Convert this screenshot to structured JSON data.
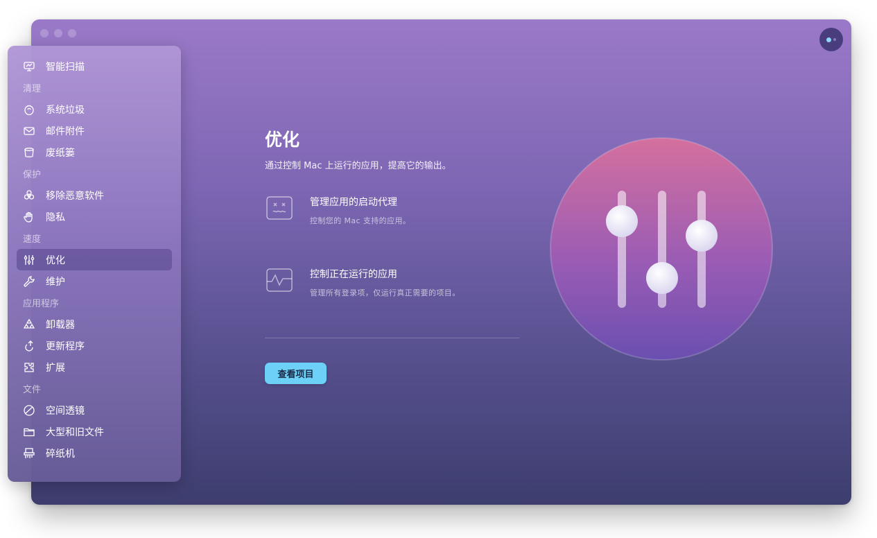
{
  "sidebar": {
    "smart_scan": "智能扫描",
    "sections": [
      {
        "label": "清理",
        "items": [
          {
            "label": "系统垃圾",
            "icon": "system-junk-icon"
          },
          {
            "label": "邮件附件",
            "icon": "mail-icon"
          },
          {
            "label": "废纸篓",
            "icon": "trash-icon"
          }
        ]
      },
      {
        "label": "保护",
        "items": [
          {
            "label": "移除恶意软件",
            "icon": "biohazard-icon"
          },
          {
            "label": "隐私",
            "icon": "hand-icon"
          }
        ]
      },
      {
        "label": "速度",
        "items": [
          {
            "label": "优化",
            "icon": "sliders-icon",
            "active": true
          },
          {
            "label": "维护",
            "icon": "wrench-icon"
          }
        ]
      },
      {
        "label": "应用程序",
        "items": [
          {
            "label": "卸载器",
            "icon": "uninstaller-icon"
          },
          {
            "label": "更新程序",
            "icon": "updater-icon"
          },
          {
            "label": "扩展",
            "icon": "extensions-icon"
          }
        ]
      },
      {
        "label": "文件",
        "items": [
          {
            "label": "空间透镜",
            "icon": "space-lens-icon"
          },
          {
            "label": "大型和旧文件",
            "icon": "folder-icon"
          },
          {
            "label": "碎纸机",
            "icon": "shredder-icon"
          }
        ]
      }
    ]
  },
  "main": {
    "title": "优化",
    "subtitle": "通过控制 Mac 上运行的应用，提高它的输出。",
    "features": [
      {
        "title": "管理应用的启动代理",
        "desc": "控制您的 Mac 支持的应用。",
        "icon": "launch-agent-icon"
      },
      {
        "title": "控制正在运行的应用",
        "desc": "管理所有登录项，仅运行真正需要的项目。",
        "icon": "running-apps-icon"
      }
    ],
    "view_button": "查看项目"
  },
  "colors": {
    "accent_button": "#6cd0f7",
    "hero_top": "#d4709e",
    "hero_bottom": "#6a4fb0"
  }
}
